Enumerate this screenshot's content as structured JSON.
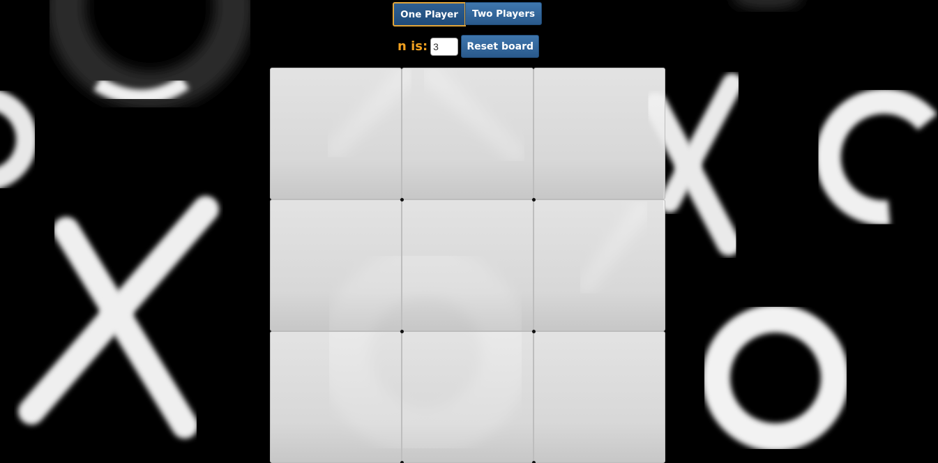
{
  "controls": {
    "one_player_label": "One Player",
    "two_players_label": "Two Players",
    "n_label": "n is:",
    "n_value": "3",
    "reset_label": "Reset board",
    "selected_mode": "One Player"
  },
  "board": {
    "size": 3,
    "cells": [
      "",
      "",
      "",
      "",
      "",
      "",
      "",
      "",
      ""
    ]
  },
  "colors": {
    "accent": "#f0a020",
    "button": "#2f6294",
    "background": "#000000"
  },
  "background_icons": [
    "x-icon",
    "o-icon"
  ]
}
